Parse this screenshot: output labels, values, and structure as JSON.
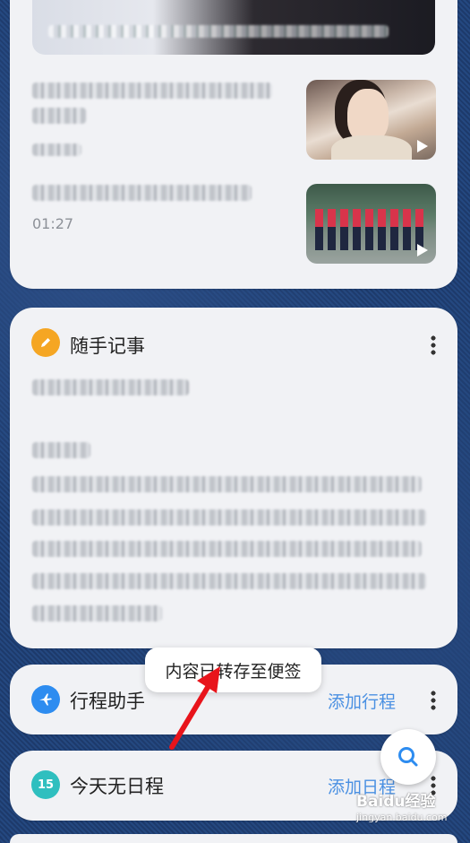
{
  "news": {
    "items": [
      {
        "duration": "01:27"
      }
    ]
  },
  "notes_card": {
    "title": "随手记事"
  },
  "toast": {
    "text": "内容已转存至便签"
  },
  "trip_card": {
    "title": "行程助手",
    "action": "添加行程"
  },
  "schedule_card": {
    "day": "15",
    "title": "今天无日程",
    "action": "添加日程"
  },
  "watermark": {
    "text": "Baidu经验",
    "url": "jingyan.baidu.com"
  },
  "colors": {
    "notes_icon": "#f5a623",
    "trip_icon": "#2d8cf0",
    "schedule_icon": "#2fbfbf",
    "action_blue": "#4a90e2",
    "arrow_red": "#e8141b"
  },
  "icons": {
    "notes": "pencil-icon",
    "trip": "airplane-icon",
    "search": "search-icon",
    "more": "more-vertical-icon"
  }
}
